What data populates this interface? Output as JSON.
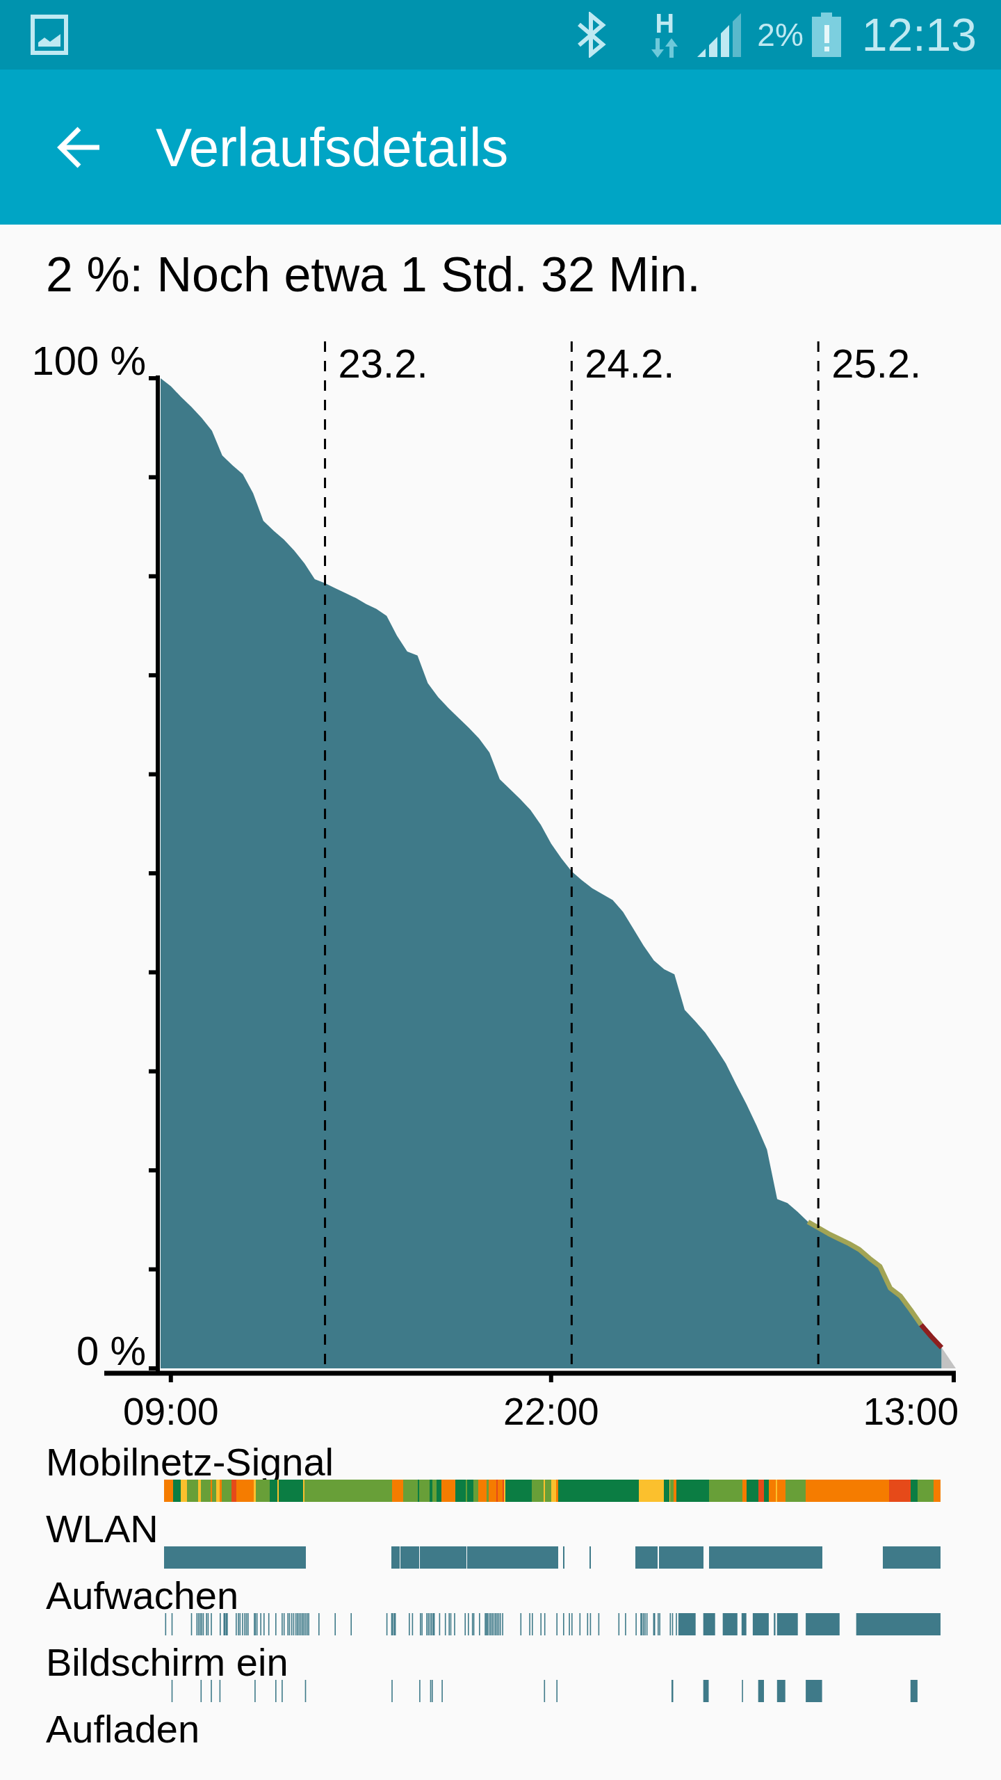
{
  "status_bar": {
    "network_type": "H",
    "battery_text": "2%",
    "time": "12:13"
  },
  "app_bar": {
    "title": "Verlaufsdetails"
  },
  "summary": "2 %: Noch etwa 1 Std. 32 Min.",
  "battery_chart": {
    "chart_data": {
      "type": "area",
      "grid": true,
      "categories": [
        null,
        "09:00",
        null,
        null,
        null,
        null,
        null,
        null,
        null,
        null,
        null,
        null,
        null,
        null,
        null,
        null,
        null,
        null,
        null,
        null,
        null,
        null,
        null,
        null,
        null,
        null,
        null,
        null,
        null,
        null,
        null,
        null,
        null,
        null,
        null,
        null,
        null,
        null,
        "22:00",
        null,
        null,
        null,
        null,
        null,
        null,
        null,
        null,
        null,
        null,
        null,
        null,
        null,
        null,
        null,
        null,
        null,
        null,
        null,
        null,
        null,
        null,
        null,
        null,
        null,
        null,
        null,
        null,
        null,
        null,
        null,
        null,
        null,
        null,
        "13:00",
        null,
        null,
        null,
        null
      ],
      "series": [
        {
          "color": "#3f7a89",
          "values": [
            100,
            99.2,
            98.1,
            97.1,
            96.0,
            94.7,
            92.2,
            91.2,
            90.3,
            88.4,
            85.6,
            84.6,
            83.7,
            82.6,
            81.3,
            79.7,
            79.3,
            78.8,
            78.3,
            77.8,
            77.2,
            76.7,
            76.0,
            74.0,
            72.4,
            72.0,
            69.2,
            67.8,
            66.7,
            65.7,
            64.7,
            63.6,
            62.2,
            59.5,
            58.5,
            57.5,
            56.4,
            54.9,
            53.0,
            51.5,
            50.2,
            49.3,
            48.5,
            47.9,
            47.3,
            46.1,
            44.4,
            42.7,
            41.2,
            40.3,
            39.8,
            36.2,
            35.1,
            33.9,
            32.4,
            30.8,
            28.7,
            26.7,
            24.5,
            22.1,
            17.1,
            16.7,
            15.8,
            14.8,
            14.2,
            13.6,
            13.1,
            12.6,
            12.0,
            11.1,
            10.3,
            8.1,
            7.3,
            5.9,
            4.4,
            3.2,
            2.1,
            null
          ]
        },
        {
          "type": "line",
          "color": "#a2a455",
          "values": [
            null,
            null,
            null,
            null,
            null,
            null,
            null,
            null,
            null,
            null,
            null,
            null,
            null,
            null,
            null,
            null,
            null,
            null,
            null,
            null,
            null,
            null,
            null,
            null,
            null,
            null,
            null,
            null,
            null,
            null,
            null,
            null,
            null,
            null,
            null,
            null,
            null,
            null,
            null,
            null,
            null,
            null,
            null,
            null,
            null,
            null,
            null,
            null,
            null,
            null,
            null,
            null,
            null,
            null,
            null,
            null,
            null,
            null,
            null,
            null,
            null,
            null,
            null,
            14.8,
            14.2,
            13.6,
            13.1,
            12.6,
            12.0,
            11.1,
            10.3,
            8.1,
            7.3,
            5.9,
            4.4,
            null,
            null,
            null
          ]
        },
        {
          "type": "line",
          "color": "#8e1f1f",
          "values": [
            null,
            null,
            null,
            null,
            null,
            null,
            null,
            null,
            null,
            null,
            null,
            null,
            null,
            null,
            null,
            null,
            null,
            null,
            null,
            null,
            null,
            null,
            null,
            null,
            null,
            null,
            null,
            null,
            null,
            null,
            null,
            null,
            null,
            null,
            null,
            null,
            null,
            null,
            null,
            null,
            null,
            null,
            null,
            null,
            null,
            null,
            null,
            null,
            null,
            null,
            null,
            null,
            null,
            null,
            null,
            null,
            null,
            null,
            null,
            null,
            null,
            null,
            null,
            null,
            null,
            null,
            null,
            null,
            null,
            null,
            null,
            null,
            null,
            null,
            4.4,
            3.2,
            2.1,
            null
          ]
        }
      ],
      "ylim": [
        0,
        100
      ],
      "yticks": [
        {
          "value": 0,
          "label": "0 %"
        },
        {
          "value": 100,
          "label": "100 %"
        }
      ],
      "annotations": [
        "23.2.",
        "24.2.",
        "25.2."
      ]
    }
  },
  "tracks": [
    {
      "label": "Mobilnetz-Signal",
      "kind": "signal"
    },
    {
      "label": "WLAN",
      "kind": "wifi"
    },
    {
      "label": "Aufwachen",
      "kind": "awake"
    },
    {
      "label": "Bildschirm ein",
      "kind": "screen"
    },
    {
      "label": "Aufladen",
      "kind": "charging"
    }
  ]
}
